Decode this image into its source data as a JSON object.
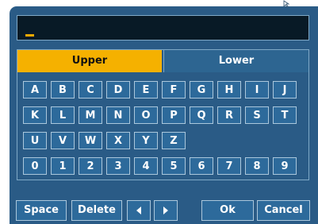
{
  "keyboard": {
    "case_tabs": {
      "upper": "Upper",
      "lower": "Lower",
      "selected": "upper"
    },
    "rows": [
      [
        "A",
        "B",
        "C",
        "D",
        "E",
        "F",
        "G",
        "H",
        "I",
        "J"
      ],
      [
        "K",
        "L",
        "M",
        "N",
        "O",
        "P",
        "Q",
        "R",
        "S",
        "T"
      ],
      [
        "U",
        "V",
        "W",
        "X",
        "Y",
        "Z"
      ],
      [
        "0",
        "1",
        "2",
        "3",
        "4",
        "5",
        "6",
        "7",
        "8",
        "9"
      ]
    ]
  },
  "actions": {
    "space": "Space",
    "delete": "Delete",
    "ok": "Ok",
    "cancel": "Cancel"
  },
  "icons": {
    "left": "arrow-left-icon",
    "right": "arrow-right-icon",
    "pointer": "mouse-pointer-icon"
  },
  "colors": {
    "panel": "#2a5b86",
    "input_background": "#081a26",
    "selected_tab": "#f5b100",
    "key": "#2d6a9b",
    "cursor": "#f2a900"
  }
}
